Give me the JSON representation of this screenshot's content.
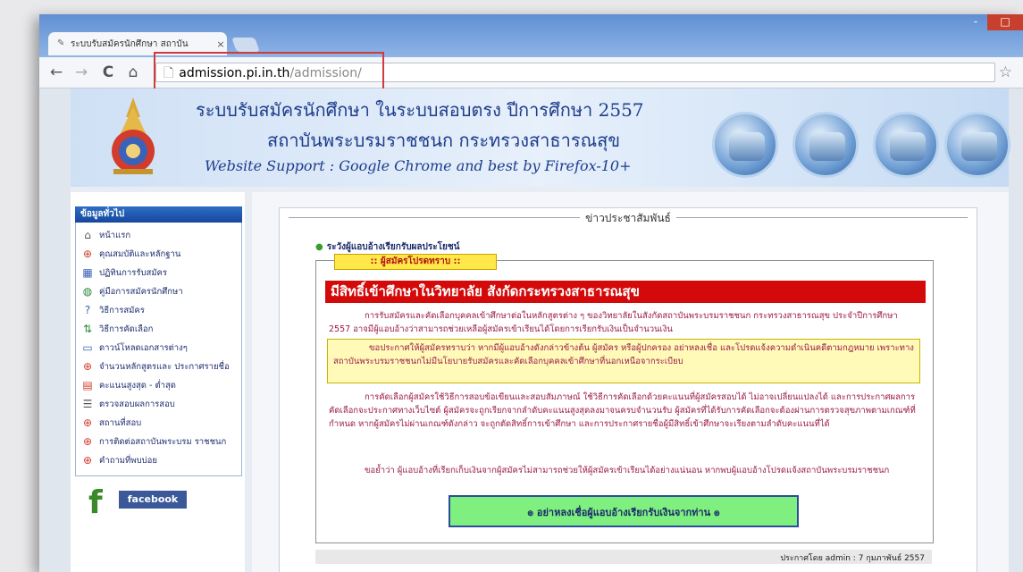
{
  "browser": {
    "tab_title": "ระบบรับสมัครนักศึกษา สถาบัน",
    "tab_close": "×",
    "url_host": "admission.pi.in.th",
    "url_path": "/admission/",
    "back": "←",
    "forward": "→",
    "reload": "C",
    "home": "⌂",
    "star": "☆",
    "minimize": "-",
    "maximize": "□"
  },
  "banner": {
    "line1": "ระบบรับสมัครนักศึกษา ในระบบสอบตรง ปีการศึกษา 2557",
    "line2": "สถาบันพระบรมราชชนก กระทรวงสาธารณสุข",
    "line3": "Website Support : Google Chrome and best by Firefox-10+"
  },
  "sidebar": {
    "header": "ข้อมูลทั่วไป",
    "items": [
      {
        "label": "หน้าแรก",
        "icon": "home-icon"
      },
      {
        "label": "คุณสมบัติและหลักฐาน",
        "icon": "lifebuoy-icon"
      },
      {
        "label": "ปฏิทินการรับสมัคร",
        "icon": "calendar-icon"
      },
      {
        "label": "คู่มือการสมัครนักศึกษา",
        "icon": "globe-icon"
      },
      {
        "label": "วิธีการสมัคร",
        "icon": "help-icon"
      },
      {
        "label": "วิธีการคัดเลือก",
        "icon": "arrows-icon"
      },
      {
        "label": "ดาวน์โหลดเอกสารต่างๆ",
        "icon": "document-icon"
      },
      {
        "label": "จำนวนหลักสูตรและ ประกาศรายชื่อ",
        "icon": "lifebuoy-icon"
      },
      {
        "label": "คะแนนสูงสุด - ต่ำสุด",
        "icon": "chart-icon"
      },
      {
        "label": "ตรวจสอบผลการสอบ",
        "icon": "list-icon"
      },
      {
        "label": "สถานที่สอบ",
        "icon": "lifebuoy-icon"
      },
      {
        "label": "การติดต่อสถาบันพระบรม ราชชนก",
        "icon": "lifebuoy-icon"
      },
      {
        "label": "คำถามที่พบบ่อย",
        "icon": "lifebuoy-icon"
      }
    ],
    "facebook_label": "facebook"
  },
  "main": {
    "title": "ข่าวประชาสัมพันธ์",
    "announce_label": "ระวังผู้แอบอ้างเรียกรับผลประโยชน์",
    "tag": ":: ผู้สมัครโปรดทราบ ::",
    "headline": "มีสิทธิ์เข้าศึกษาในวิทยาลัย สังกัดกระทรวงสาธารณสุข",
    "para1": "การรับสมัครและคัดเลือกบุคคลเข้าศึกษาต่อในหลักสูตรต่าง ๆ ของวิทยาลัยในสังกัดสถาบันพระบรมราชชนก กระทรวงสาธารณสุข ประจำปีการศึกษา 2557 อาจมีผู้แอบอ้างว่าสามารถช่วยเหลือผู้สมัครเข้าเรียนได้โดยการเรียกรับเงินเป็นจำนวนเงิน",
    "note": "ขอประกาศให้ผู้สมัครทราบว่า หากมีผู้แอบอ้างดังกล่าวข้างต้น ผู้สมัคร หรือผู้ปกครอง อย่าหลงเชื่อ และโปรดแจ้งความดำเนินคดีตามกฎหมาย เพราะทางสถาบันพระบรมราชชนกไม่มีนโยบายรับสมัครและคัดเลือกบุคคลเข้าศึกษาที่นอกเหนือจากระเบียบ",
    "para2": "การคัดเลือกผู้สมัครใช้วิธีการสอบข้อเขียนและสอบสัมภาษณ์ ใช้วิธีการคัดเลือกด้วยคะแนนที่ผู้สมัครสอบได้ ไม่อาจเปลี่ยนแปลงได้ และการประกาศผลการคัดเลือกจะประกาศทางเว็บไซต์ ผู้สมัครจะถูกเรียกจากลำดับคะแนนสูงสุดลงมาจนครบจำนวนรับ ผู้สมัครที่ได้รับการคัดเลือกจะต้องผ่านการตรวจสุขภาพตามเกณฑ์ที่กำหนด หากผู้สมัครไม่ผ่านเกณฑ์ดังกล่าว จะถูกตัดสิทธิ์การเข้าศึกษา และการประกาศรายชื่อผู้มีสิทธิ์เข้าศึกษาจะเรียงตามลำดับคะแนนที่ได้",
    "para3": "ขอย้ำว่า ผู้แอบอ้างที่เรียกเก็บเงินจากผู้สมัครไม่สามารถช่วยให้ผู้สมัครเข้าเรียนได้อย่างแน่นอน หากพบผู้แอบอ้างโปรดแจ้งสถาบันพระบรมราชชนก",
    "button": "๏ อย่าหลงเชื่อผู้แอบอ้างเรียกรับเงินจากท่าน ๏",
    "footer_date": "ประกาศโดย admin : 7 กุมภาพันธ์ 2557"
  },
  "colors": {
    "headline_bg": "#d40a0a",
    "button_bg": "#7ff07f",
    "tag_bg": "#ffe94a",
    "sidebar_header": "#1f58b0"
  }
}
